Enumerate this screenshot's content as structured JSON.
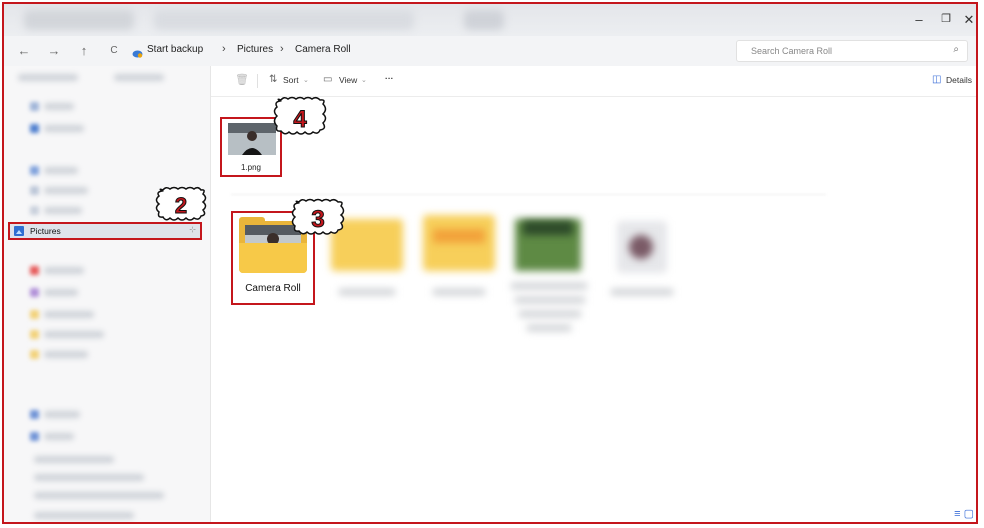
{
  "window": {
    "minimize": "–",
    "maximize": "❐",
    "close": "✕"
  },
  "addressbar": {
    "back": "←",
    "forward": "→",
    "up": "↑",
    "refresh": "C",
    "breadcrumb": [
      "Start backup",
      "Pictures",
      "Camera Roll"
    ],
    "separator": "›",
    "search_placeholder": "Search Camera Roll"
  },
  "sidebar": {
    "selected_item": "Pictures"
  },
  "toolbar": {
    "sort_label": "Sort",
    "view_label": "View",
    "more_label": "···",
    "details_label": "Details"
  },
  "files": [
    {
      "name": "1.png"
    }
  ],
  "folders": [
    {
      "name": "Camera Roll"
    }
  ],
  "callouts": [
    "2",
    "3",
    "4"
  ],
  "colors": {
    "highlight": "#c4161c",
    "folder": "#f7c948",
    "accent": "#2f6fd1"
  }
}
